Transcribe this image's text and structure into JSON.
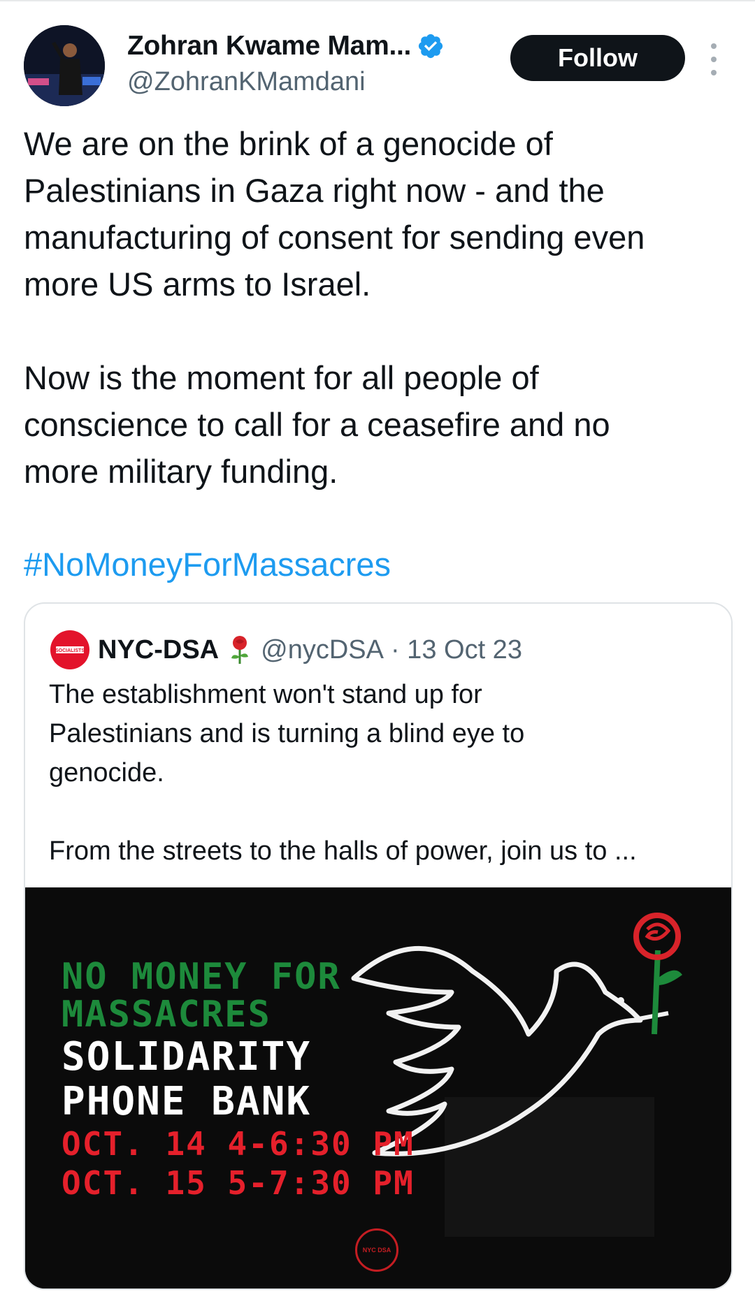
{
  "author": {
    "display_name": "Zohran Kwame Mam...",
    "handle": "@ZohranKMamdani",
    "verified": true,
    "avatar_icon": "profile-photo"
  },
  "actions": {
    "follow_label": "Follow",
    "more_icon": "vertical-ellipsis-icon"
  },
  "tweet": {
    "text": "We are on the brink of a genocide of\nPalestinians in Gaza right now - and the\nmanufacturing of consent for sending even\nmore US arms to Israel.\n\nNow is the moment for all people of\nconscience to call for a ceasefire and no\nmore military funding.",
    "hashtag": "#NoMoneyForMassacres"
  },
  "quoted_tweet": {
    "display_name": "NYC-DSA",
    "emoji": "🌹",
    "handle": "@nycDSA",
    "date": "· 13 Oct 23",
    "text": "The establishment won't stand up for\nPalestinians and is turning a blind eye to\ngenocide.\n\nFrom the streets to the halls of power, join us to ...",
    "logo_text": "SOCIALISTS"
  },
  "poster": {
    "line1": "NO MONEY FOR",
    "line2": "MASSACRES",
    "line3": "SOLIDARITY",
    "line4": "PHONE BANK",
    "line5": "OCT. 14 4-6:30 PM",
    "line6": "OCT. 15 5-7:30 PM",
    "badge_text": "NYC DSA"
  },
  "colors": {
    "text": "#0f1419",
    "secondary": "#536471",
    "link": "#1d9bf0",
    "verified": "#1d9bf0",
    "poster_bg": "#0a0a0a",
    "poster_green": "#1d8a3b",
    "poster_red": "#e5202b"
  }
}
